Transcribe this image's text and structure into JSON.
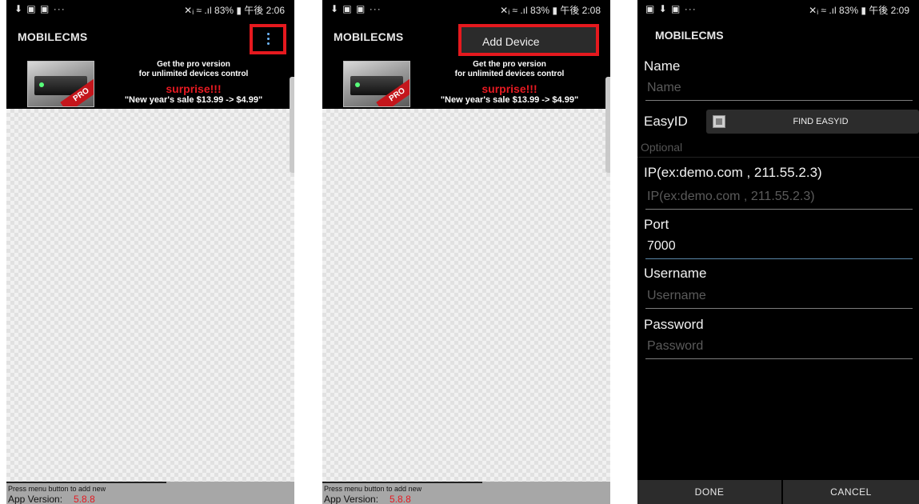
{
  "app": {
    "title": "MOBILECMS"
  },
  "status": {
    "left_1": "⬇ ▣ ▣ ···",
    "right_1": "✕ᵢ ≈ .ıl 83% ▮ 午後 2:06",
    "left_2": "⬇ ▣ ▣ ···",
    "right_2": "✕ᵢ ≈ .ıl 83% ▮ 午後 2:08",
    "left_3": "▣ ⬇ ▣ ···",
    "right_3": "✕ᵢ ≈ .ıl 83% ▮ 午後 2:09"
  },
  "banner": {
    "line1": "Get the pro version",
    "line2": "for unlimited devices control",
    "line3": "surprise!!!",
    "line4": "\"New year's sale  $13.99 -> $4.99\"",
    "pro": "PRO"
  },
  "footer": {
    "press_text": "Press menu button to add new",
    "version_label": "App Version:",
    "version_value": "5.8.8"
  },
  "menu": {
    "add_device": "Add Device"
  },
  "form": {
    "name_label": "Name",
    "name_placeholder": "Name",
    "easyid_label": "EasyID",
    "find_easyid": "FIND EASYID",
    "optional": "Optional",
    "ip_label": "IP(ex:demo.com , 211.55.2.3)",
    "ip_placeholder": "IP(ex:demo.com , 211.55.2.3)",
    "port_label": "Port",
    "port_value": "7000",
    "username_label": "Username",
    "username_placeholder": "Username",
    "password_label": "Password",
    "password_placeholder": "Password",
    "done": "DONE",
    "cancel": "CANCEL"
  },
  "colors": {
    "accent_red": "#e5191e",
    "banner_red": "#e61a22",
    "icon_blue": "#6fb8ff"
  }
}
